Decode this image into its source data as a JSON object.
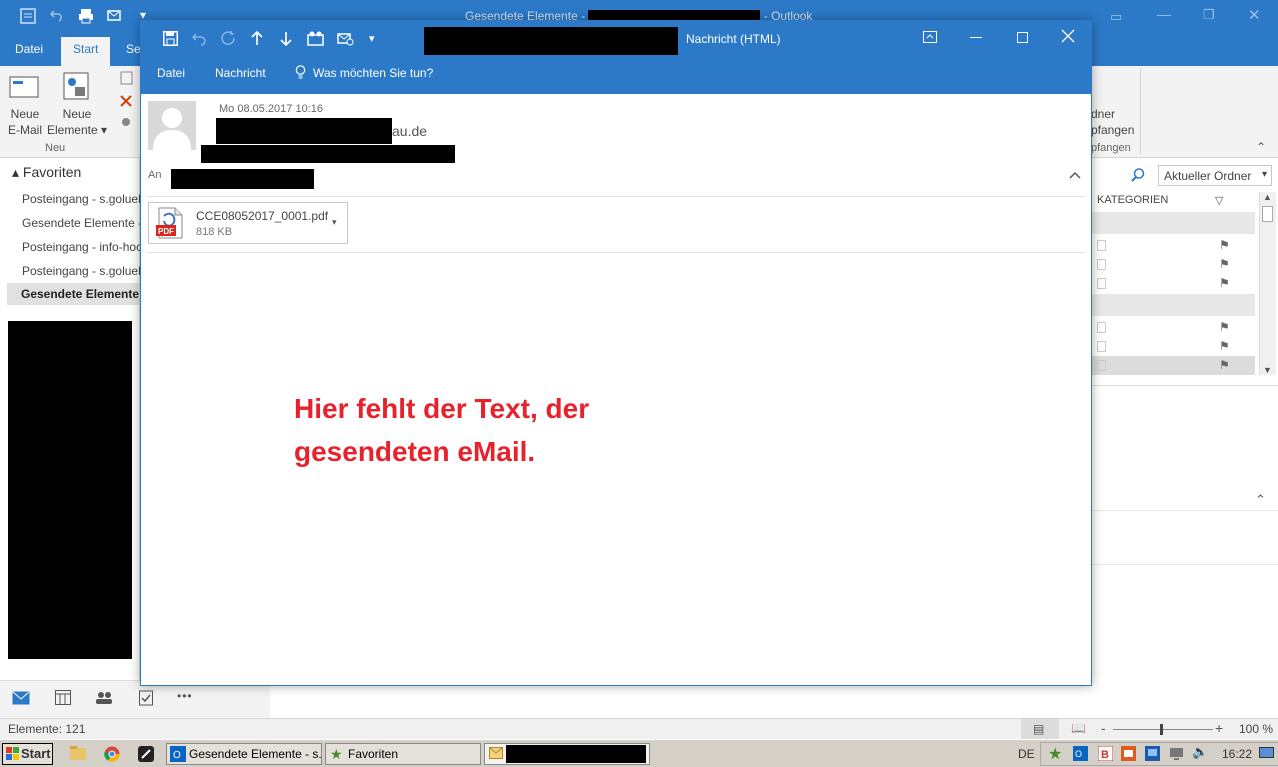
{
  "background_window": {
    "title_prefix": "Gesendete Elemente - ",
    "title_suffix": " -  Outlook",
    "tabs": [
      "Datei",
      "Start",
      "Se"
    ],
    "ribbon": {
      "new_email": "Neue\nE-Mail",
      "new_items": "Neue\nElemente ▾",
      "group_new": "Neu",
      "right_line1": "dner",
      "right_line2": "pfangen",
      "right_group": "pfangen"
    },
    "search_scope": "Aktueller Ordner",
    "favorites_header": "Favoriten",
    "favorites": [
      {
        "label": "Posteingang - s.goluek",
        "selected": false
      },
      {
        "label": "Gesendete Elemente - ",
        "selected": false
      },
      {
        "label": "Posteingang - info-hoc",
        "selected": false
      },
      {
        "label": "Posteingang - s.goluek",
        "selected": false
      },
      {
        "label": "Gesendete Elemente",
        "selected": true
      }
    ],
    "column_header": "KATEGORIEN",
    "status": "Elemente: 121",
    "zoom": "100 %",
    "nav_more": "•••"
  },
  "message_window": {
    "title": "Nachricht (HTML)",
    "menu": {
      "file": "Datei",
      "message": "Nachricht",
      "tell_me": "Was möchten Sie tun?"
    },
    "date": "Mo 08.05.2017 10:16",
    "from_suffix": "au.de",
    "to_label": "An",
    "attachment": {
      "name": "CCE08052017_0001.pdf",
      "size": "818 KB",
      "badge": "PDF"
    },
    "note_line1": "Hier fehlt der Text, der",
    "note_line2": "gesendeten eMail."
  },
  "taskbar": {
    "start": "Start",
    "items": [
      "Gesendete Elemente - s....",
      "Favoriten"
    ],
    "language": "DE",
    "clock": "16:22"
  },
  "colors": {
    "outlook_blue": "#2b79c7",
    "note_red": "#e8222d",
    "ribbon_gray": "#f3f3f3"
  }
}
